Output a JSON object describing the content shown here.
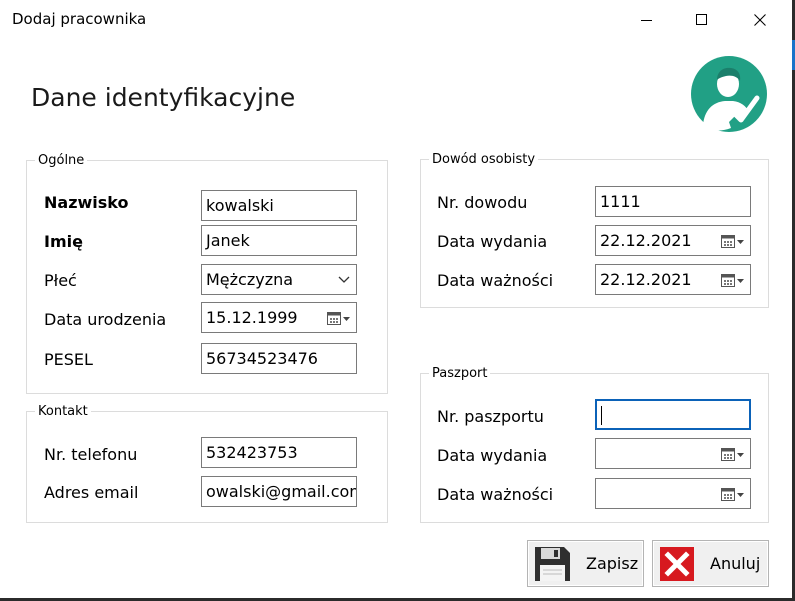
{
  "window": {
    "title": "Dodaj pracownika"
  },
  "heading": "Dane identyfikacyjne",
  "general": {
    "legend": "Ogólne",
    "surname_label": "Nazwisko",
    "surname_value": "kowalski",
    "firstname_label": "Imię",
    "firstname_value": "Janek",
    "gender_label": "Płeć",
    "gender_value": "Mężczyzna",
    "birthdate_label": "Data urodzenia",
    "birthdate_value": "15.12.1999",
    "pesel_label": "PESEL",
    "pesel_value": "56734523476"
  },
  "contact": {
    "legend": "Kontakt",
    "phone_label": "Nr. telefonu",
    "phone_value": "532423753",
    "email_label": "Adres email",
    "email_value": "owalski@gmail.com"
  },
  "id_card": {
    "legend": "Dowód osobisty",
    "number_label": "Nr. dowodu",
    "number_value": "1111",
    "issue_label": "Data wydania",
    "issue_value": "22.12.2021",
    "expiry_label": "Data ważności",
    "expiry_value": "22.12.2021"
  },
  "passport": {
    "legend": "Paszport",
    "number_label": "Nr. paszportu",
    "number_value": "",
    "issue_label": "Data wydania",
    "issue_value": "",
    "expiry_label": "Data ważności",
    "expiry_value": ""
  },
  "actions": {
    "save_label": "Zapisz",
    "cancel_label": "Anuluj"
  },
  "icons": {
    "logo": "user-check-icon",
    "save": "floppy-disk-icon",
    "cancel": "red-x-icon",
    "date": "calendar-icon",
    "dropdown": "chevron-down-icon"
  },
  "colors": {
    "logo_bg": "#21a085",
    "cancel_red": "#d7191f",
    "focus_border": "#0b62b8"
  }
}
